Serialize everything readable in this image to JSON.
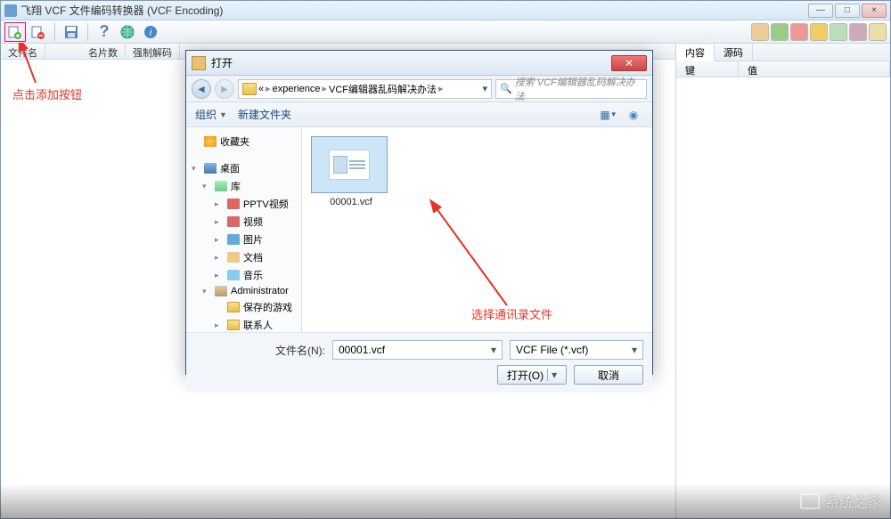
{
  "window": {
    "title": "飞翔 VCF 文件编码转换器 (VCF Encoding)"
  },
  "left_panel": {
    "cols": [
      "文件名",
      "名片数",
      "强制解码"
    ]
  },
  "right_panel": {
    "tabs": [
      "内容",
      "源码"
    ],
    "cols": [
      "键",
      "值"
    ]
  },
  "annotations": {
    "add_button": "点击添加按钮",
    "select_file": "选择通讯录文件"
  },
  "dialog": {
    "title": "打开",
    "path_parts": [
      "«",
      "experience",
      "VCF编辑器乱码解决办法"
    ],
    "search_placeholder": "搜索 VCF编辑器乱码解决办法",
    "toolbar": {
      "organize": "组织",
      "new_folder": "新建文件夹"
    },
    "tree": {
      "favorites": "收藏夹",
      "desktop": "桌面",
      "library": "库",
      "pptv": "PPTV视频",
      "video": "视频",
      "pictures": "图片",
      "documents": "文档",
      "music": "音乐",
      "admin": "Administrator",
      "saved_games": "保存的游戏",
      "contacts": "联系人"
    },
    "file": {
      "name": "00001.vcf"
    },
    "filename_label": "文件名(N):",
    "filename_value": "00001.vcf",
    "filter": "VCF File (*.vcf)",
    "open_btn": "打开(O)",
    "cancel_btn": "取消"
  },
  "watermark": "系统之家"
}
